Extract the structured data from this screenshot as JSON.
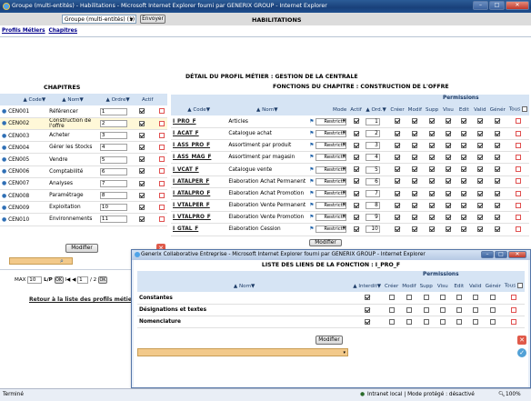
{
  "window": {
    "title": "Groupe (multi-entités) - Habilitations - Microsoft Internet Explorer fourni par GENERIX GROUP - Internet Explorer"
  },
  "toolbar": {
    "group_select": "Groupe (multi-entités) (1)",
    "send_label": "Envoyer",
    "page_title": "HABILITATIONS"
  },
  "tabs": [
    "Profils Métiers",
    "Chapitres"
  ],
  "left": {
    "heading": "CHAPITRES",
    "columns": [
      "Code",
      "Nom",
      "Ordre",
      "Actif"
    ],
    "rows": [
      {
        "code": "CEN001",
        "nom": "Référencer",
        "ordre": "1",
        "actif": true
      },
      {
        "code": "CEN002",
        "nom": "Construction de l'offre",
        "ordre": "2",
        "actif": true
      },
      {
        "code": "CEN003",
        "nom": "Acheter",
        "ordre": "3",
        "actif": true
      },
      {
        "code": "CEN004",
        "nom": "Gérer les Stocks",
        "ordre": "4",
        "actif": true
      },
      {
        "code": "CEN005",
        "nom": "Vendre",
        "ordre": "5",
        "actif": true
      },
      {
        "code": "CEN006",
        "nom": "Comptabilité",
        "ordre": "6",
        "actif": true
      },
      {
        "code": "CEN007",
        "nom": "Analyses",
        "ordre": "7",
        "actif": true
      },
      {
        "code": "CEN008",
        "nom": "Paramétrage",
        "ordre": "8",
        "actif": true
      },
      {
        "code": "CEN009",
        "nom": "Exploitation",
        "ordre": "10",
        "actif": true
      },
      {
        "code": "CEN010",
        "nom": "Environnements",
        "ordre": "11",
        "actif": true
      }
    ],
    "modify_label": "Modifier",
    "pager": {
      "max_label": "MAX",
      "max_value": "10",
      "lp_label": "L/P",
      "ok_label": "OK",
      "nav": "I◀ ◀",
      "page": "1",
      "of": "/ 2",
      "ok2": "OK"
    },
    "back_link": "Retour à la liste des profils métier"
  },
  "right": {
    "heading_detail": "DÉTAIL DU PROFIL MÉTIER : GESTION DE LA CENTRALE",
    "heading_chapter": "FONCTIONS DU CHAPITRE : CONSTRUCTION DE L'OFFRE",
    "permissions_label": "Permissions",
    "columns": [
      "Code",
      "Nom",
      "Mode",
      "Actif",
      "Ord.",
      "Créer",
      "Modif",
      "Supp",
      "Visu",
      "Edit",
      "Valid",
      "Génér",
      "Tous"
    ],
    "rows": [
      {
        "code": "I_PRO_F",
        "nom": "Articles",
        "mode": "Restrictif",
        "ord": "1"
      },
      {
        "code": "I_ACAT_F",
        "nom": "Catalogue achat",
        "mode": "Restrictif",
        "ord": "2"
      },
      {
        "code": "I_ASS_PRO_F",
        "nom": "Assortiment par produit",
        "mode": "Restrictif",
        "ord": "3"
      },
      {
        "code": "I_ASS_MAG_F",
        "nom": "Assortiment par magasin",
        "mode": "Restrictif",
        "ord": "4"
      },
      {
        "code": "I_VCAT_F",
        "nom": "Catalogue vente",
        "mode": "Restrictif",
        "ord": "5"
      },
      {
        "code": "I_ATALPER_F",
        "nom": "Elaboration Achat Permanent",
        "mode": "Restrictif",
        "ord": "6"
      },
      {
        "code": "I_ATALPRO_F",
        "nom": "Elaboration Achat Promotion",
        "mode": "Restrictif",
        "ord": "7"
      },
      {
        "code": "I_VTALPER_F",
        "nom": "Elaboration Vente Permanent",
        "mode": "Restrictif",
        "ord": "8"
      },
      {
        "code": "I_VTALPRO_F",
        "nom": "Elaboration Vente Promotion",
        "mode": "Restrictif",
        "ord": "9"
      },
      {
        "code": "I_GTAL_F",
        "nom": "Elaboration Cession",
        "mode": "Restrictif",
        "ord": "10"
      }
    ],
    "modify_label": "Modifier"
  },
  "popup": {
    "title": "Generix Collaborative Entreprise - Microsoft Internet Explorer fourni par GENERIX GROUP - Internet Explorer",
    "heading": "LISTE DES LIENS DE LA FONCTION : I_PRO_F",
    "permissions_label": "Permissions",
    "columns": [
      "Nom",
      "Interdit",
      "Créer",
      "Modif",
      "Supp",
      "Visu",
      "Edit",
      "Valid",
      "Génér",
      "Tous"
    ],
    "rows": [
      {
        "nom": "Constantes"
      },
      {
        "nom": "Désignations et textes"
      },
      {
        "nom": "Nomenclature"
      }
    ],
    "modify_label": "Modifier"
  },
  "status": {
    "left": "Terminé",
    "zone": "Intranet local | Mode protégé : désactivé",
    "zoom": "100%"
  }
}
